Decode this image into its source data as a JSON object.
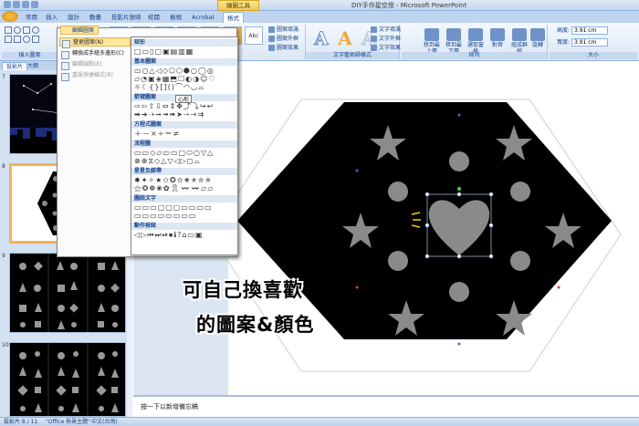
{
  "app": {
    "title": "DIY手作星空燈 - Microsoft PowerPoint",
    "contextual_group": "繪圖工具"
  },
  "tabs": [
    "常用",
    "插入",
    "設計",
    "動畫",
    "投影片放映",
    "校閱",
    "檢視",
    "Acrobat",
    "格式"
  ],
  "ribbon": {
    "shape_style_sample": "Abc",
    "groups": {
      "insert_shapes": "插入圖案",
      "wordart_styles": "文字藝術師樣式",
      "arrange": "排列",
      "size": "大小"
    },
    "fill": "圖案填滿",
    "outline": "圖案外框",
    "effects": "圖案效果",
    "text_fill": "文字填滿",
    "text_outline": "文字外框",
    "text_effects": "文字效果",
    "bring_forward": "移到最上層",
    "send_backward": "移到最下層",
    "selection_pane": "選取窗格",
    "align": "對齊",
    "group": "組成群組",
    "rotate": "旋轉",
    "height_label": "高度:",
    "height_value": "3.91 cm",
    "width_label": "寬度:",
    "width_value": "3.91 cm"
  },
  "dropdown": {
    "title": "編輯圖案",
    "items": [
      "變更圖案(N)",
      "轉換成手繪多邊形(C)",
      "編輯端點(E)",
      "重設快捷樣式(R)"
    ]
  },
  "shape_menu": {
    "sections": [
      "矩形",
      "基本圖案",
      "箭號圖案",
      "方程式圖案",
      "流程圖",
      "星星及綵帶",
      "圖說文字",
      "動作按鈕"
    ],
    "tooltip": "心形"
  },
  "pane": {
    "tabs": [
      "投影片",
      "大綱"
    ],
    "slide_numbers": [
      "7",
      "8",
      "9",
      "10"
    ]
  },
  "notes_text": "按一下以新增備忘稿",
  "status": {
    "slide": "投影片 8 / 11",
    "theme": "\"Office 佈景主題\"",
    "language": "中文(台灣)"
  },
  "annotation": {
    "line1": "可自己換喜歡",
    "line2": "的圖案&顏色"
  }
}
